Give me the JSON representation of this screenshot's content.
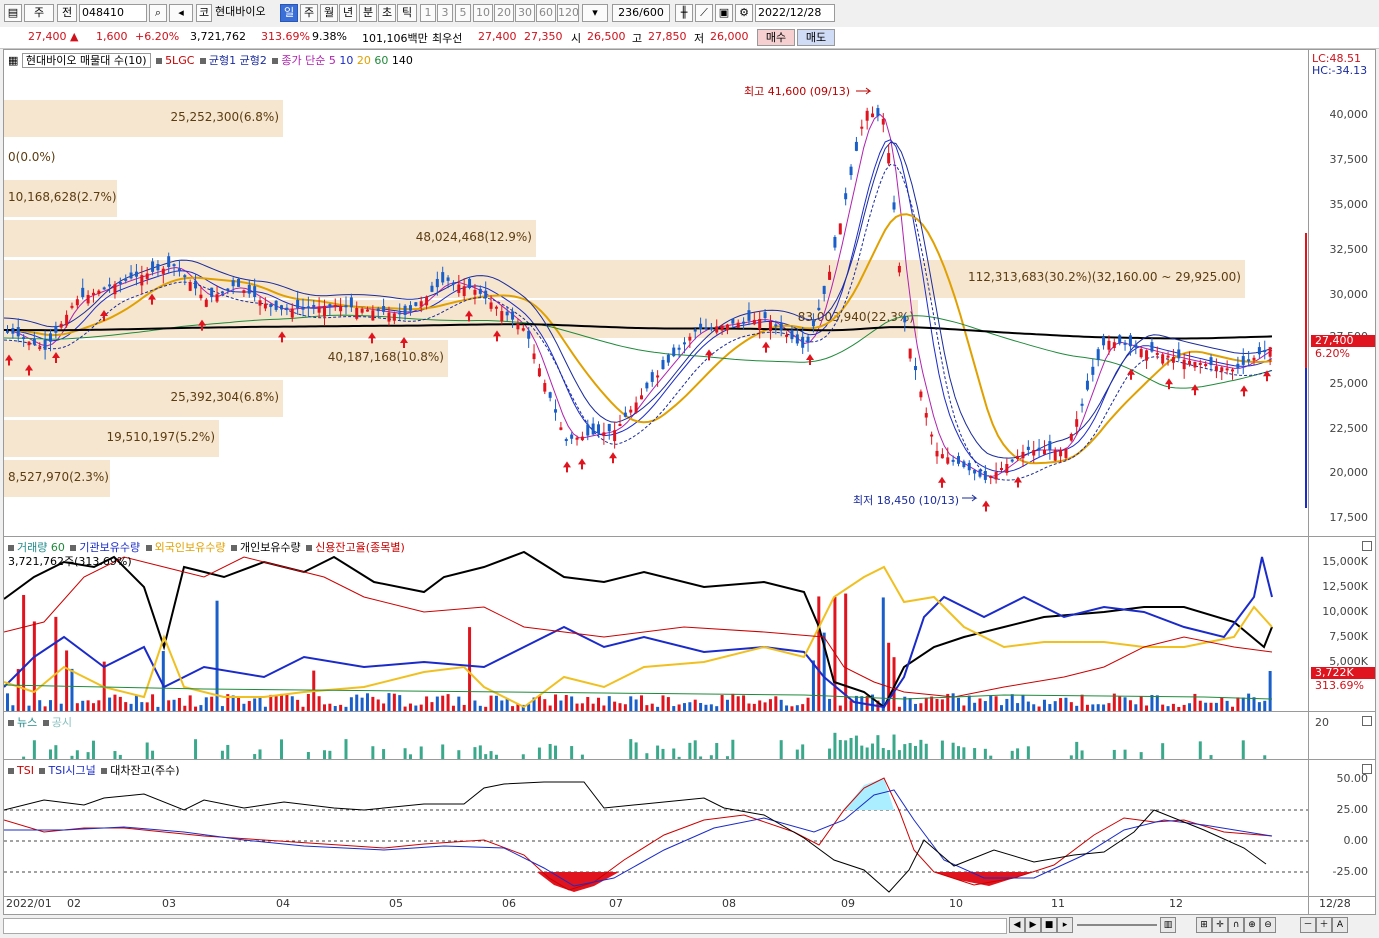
{
  "toolbar": {
    "market": "주",
    "prev": "전",
    "code": "048410",
    "market_btn": "코",
    "stock_name": "현대바이오",
    "periods": [
      "일",
      "주",
      "월",
      "년",
      "분",
      "초",
      "틱"
    ],
    "intervals": [
      "1",
      "3",
      "5",
      "10",
      "20",
      "30",
      "60",
      "120"
    ],
    "page_count": "236/600",
    "date": "2022/12/28"
  },
  "quote": {
    "price": "27,400",
    "change": "1,600",
    "rate": "+6.20%",
    "volume": "3,721,762",
    "vol_ratio": "313.69%",
    "turnover": "9.38%",
    "amount": "101,106백만",
    "best_label": "최우선",
    "best_ask": "27,400",
    "best_bid": "27,350",
    "open_label": "시",
    "open": "26,500",
    "high_label": "고",
    "high": "27,850",
    "low_label": "저",
    "low": "26,000",
    "buy": "매수",
    "sell": "매도"
  },
  "price_panel": {
    "legend_stock": "현대바이오 매물대 수(10)",
    "legend_5lgc": "5LGC",
    "legend_eq1": "균형1",
    "legend_eq2": "균형2",
    "legend_ma": "종가 단순 5",
    "ma10": "10",
    "ma20": "20",
    "ma60": "60",
    "ma140": "140",
    "lc": "LC:48.51",
    "hc": "HC:-34.13",
    "high_note": "최고 41,600 (09/13)",
    "low_note": "최저 18,450 (10/13)",
    "price_tag": "27,400",
    "rate_tag": "6.20%",
    "y_ticks": [
      "40,000",
      "37,500",
      "35,000",
      "32,500",
      "30,000",
      "27,500",
      "25,000",
      "22,500",
      "20,000",
      "17,500"
    ],
    "bands": [
      {
        "label": "25,252,300(6.8%)"
      },
      {
        "label": "0(0.0%)"
      },
      {
        "label": "10,168,628(2.7%)"
      },
      {
        "label": "48,024,468(12.9%)"
      },
      {
        "label": "112,313,683(30.2%)(32,160.00 ~ 29,925.00)"
      },
      {
        "label": "83,003,940(22.3%)"
      },
      {
        "label": "40,187,168(10.8%)"
      },
      {
        "label": "25,392,304(6.8%)"
      },
      {
        "label": "19,510,197(5.2%)"
      },
      {
        "label": "8,527,970(2.3%)"
      }
    ]
  },
  "volume_panel": {
    "legend_vol": "거래량",
    "legend_60": "60",
    "legend_inst": "기관보유수량",
    "legend_foreign": "외국인보유수량",
    "legend_indiv": "개인보유수량",
    "legend_credit": "신용잔고율(종목별)",
    "sub": "3,721,762주(313.69%)",
    "y_ticks": [
      "15,000K",
      "12,500K",
      "10,000K",
      "7,500K",
      "5,000K"
    ],
    "tag1": "3,722K",
    "tag2": "313.69%"
  },
  "news_panel": {
    "news": "뉴스",
    "disclosure": "공시",
    "tick": "20"
  },
  "tsi_panel": {
    "tsi": "TSI",
    "tsi_signal": "TSI시그널",
    "loan": "대차잔고(주수)",
    "y_ticks": [
      "50.00",
      "25.00",
      "0.00",
      "-25.00"
    ]
  },
  "x_labels": [
    "2022/01",
    "02",
    "03",
    "04",
    "05",
    "06",
    "07",
    "08",
    "09",
    "10",
    "11",
    "12"
  ],
  "x_end": "12/28",
  "chart_data": {
    "type": "line",
    "title": "",
    "x": [
      "2022/01",
      "02",
      "03",
      "04",
      "05",
      "06",
      "07",
      "08",
      "09",
      "10",
      "11",
      "12"
    ],
    "series": [
      {
        "name": "종가",
        "values": [
          28000,
          30500,
          29800,
          29200,
          29000,
          27000,
          22500,
          28500,
          40500,
          20000,
          25000,
          26800
        ]
      }
    ],
    "ylim": [
      17500,
      42500
    ]
  }
}
